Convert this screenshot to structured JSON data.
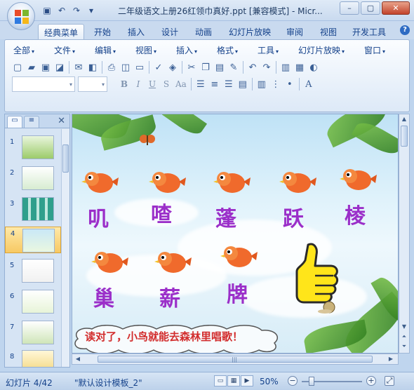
{
  "window": {
    "title": "二年级语文上册26红领巾真好.ppt [兼容模式] - Micr...",
    "minimize_label": "–",
    "maximize_label": "▢",
    "close_label": "✕"
  },
  "quick_access": [
    "save-icon",
    "undo-icon",
    "redo-icon",
    "customize-icon"
  ],
  "tabs": [
    "经典菜单",
    "开始",
    "插入",
    "设计",
    "动画",
    "幻灯片放映",
    "审阅",
    "视图",
    "开发工具"
  ],
  "active_tab": "经典菜单",
  "menus": [
    "全部",
    "文件",
    "编辑",
    "视图",
    "插入",
    "格式",
    "工具",
    "幻灯片放映",
    "窗口"
  ],
  "format_buttons": [
    "B",
    "I",
    "U",
    "S",
    "Aa"
  ],
  "slide_panel": {
    "slide_numbers": [
      "1",
      "2",
      "3",
      "4",
      "5",
      "6",
      "7",
      "8"
    ],
    "selected": "4"
  },
  "slide": {
    "characters_row1": [
      "叽",
      "喳",
      "蓬",
      "跃",
      "棱"
    ],
    "characters_row2": [
      "巢",
      "薪",
      "牌"
    ],
    "speech": "读对了，小鸟就能去森林里唱歌！"
  },
  "status": {
    "slide_info": "幻灯片 4/42",
    "template": "\"默认设计模板_2\"",
    "zoom": "50%"
  }
}
